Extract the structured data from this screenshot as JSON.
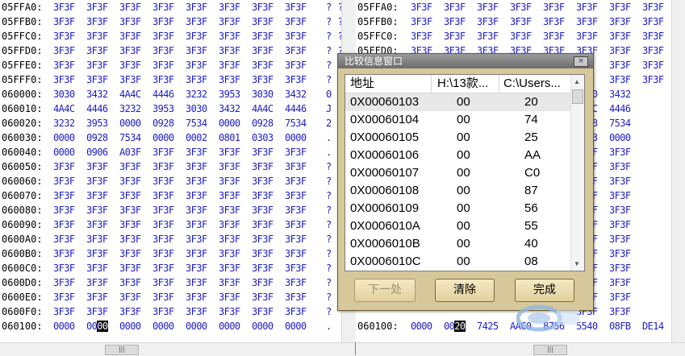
{
  "left_pane": {
    "rows": [
      {
        "addr": "05FFA0:",
        "cells": [
          "3F3F",
          "3F3F",
          "3F3F",
          "3F3F",
          "3F3F",
          "3F3F",
          "3F3F",
          "3F3F"
        ],
        "ascii": "? ?"
      },
      {
        "addr": "05FFB0:",
        "cells": [
          "3F3F",
          "3F3F",
          "3F3F",
          "3F3F",
          "3F3F",
          "3F3F",
          "3F3F",
          "3F3F"
        ],
        "ascii": "? ?"
      },
      {
        "addr": "05FFC0:",
        "cells": [
          "3F3F",
          "3F3F",
          "3F3F",
          "3F3F",
          "3F3F",
          "3F3F",
          "3F3F",
          "3F3F"
        ],
        "ascii": "? ?"
      },
      {
        "addr": "05FFD0:",
        "cells": [
          "3F3F",
          "3F3F",
          "3F3F",
          "3F3F",
          "3F3F",
          "3F3F",
          "3F3F",
          "3F3F"
        ],
        "ascii": "? ?"
      },
      {
        "addr": "05FFE0:",
        "cells": [
          "3F3F",
          "3F3F",
          "3F3F",
          "3F3F",
          "3F3F",
          "3F3F",
          "3F3F",
          "3F3F"
        ],
        "ascii": "?"
      },
      {
        "addr": "05FFF0:",
        "cells": [
          "3F3F",
          "3F3F",
          "3F3F",
          "3F3F",
          "3F3F",
          "3F3F",
          "3F3F",
          "3F3F"
        ],
        "ascii": "?"
      },
      {
        "addr": "060000:",
        "cells": [
          "3030",
          "3432",
          "4A4C",
          "4446",
          "3232",
          "3953",
          "3030",
          "3432"
        ],
        "ascii": "0"
      },
      {
        "addr": "060010:",
        "cells": [
          "4A4C",
          "4446",
          "3232",
          "3953",
          "3030",
          "3432",
          "4A4C",
          "4446"
        ],
        "ascii": "J"
      },
      {
        "addr": "060020:",
        "cells": [
          "3232",
          "3953",
          "0000",
          "0928",
          "7534",
          "0000",
          "0928",
          "7534"
        ],
        "ascii": "2"
      },
      {
        "addr": "060030:",
        "cells": [
          "0000",
          "0928",
          "7534",
          "0000",
          "0002",
          "0801",
          "0303",
          "0000"
        ],
        "ascii": "."
      },
      {
        "addr": "060040:",
        "cells": [
          "0000",
          "0906",
          "A03F",
          "3F3F",
          "3F3F",
          "3F3F",
          "3F3F",
          "3F3F"
        ],
        "ascii": "."
      },
      {
        "addr": "060050:",
        "cells": [
          "3F3F",
          "3F3F",
          "3F3F",
          "3F3F",
          "3F3F",
          "3F3F",
          "3F3F",
          "3F3F"
        ],
        "ascii": "?"
      },
      {
        "addr": "060060:",
        "cells": [
          "3F3F",
          "3F3F",
          "3F3F",
          "3F3F",
          "3F3F",
          "3F3F",
          "3F3F",
          "3F3F"
        ],
        "ascii": "?"
      },
      {
        "addr": "060070:",
        "cells": [
          "3F3F",
          "3F3F",
          "3F3F",
          "3F3F",
          "3F3F",
          "3F3F",
          "3F3F",
          "3F3F"
        ],
        "ascii": "?"
      },
      {
        "addr": "060080:",
        "cells": [
          "3F3F",
          "3F3F",
          "3F3F",
          "3F3F",
          "3F3F",
          "3F3F",
          "3F3F",
          "3F3F"
        ],
        "ascii": "?"
      },
      {
        "addr": "060090:",
        "cells": [
          "3F3F",
          "3F3F",
          "3F3F",
          "3F3F",
          "3F3F",
          "3F3F",
          "3F3F",
          "3F3F"
        ],
        "ascii": "?"
      },
      {
        "addr": "0600A0:",
        "cells": [
          "3F3F",
          "3F3F",
          "3F3F",
          "3F3F",
          "3F3F",
          "3F3F",
          "3F3F",
          "3F3F"
        ],
        "ascii": "?"
      },
      {
        "addr": "0600B0:",
        "cells": [
          "3F3F",
          "3F3F",
          "3F3F",
          "3F3F",
          "3F3F",
          "3F3F",
          "3F3F",
          "3F3F"
        ],
        "ascii": "?"
      },
      {
        "addr": "0600C0:",
        "cells": [
          "3F3F",
          "3F3F",
          "3F3F",
          "3F3F",
          "3F3F",
          "3F3F",
          "3F3F",
          "3F3F"
        ],
        "ascii": "?"
      },
      {
        "addr": "0600D0:",
        "cells": [
          "3F3F",
          "3F3F",
          "3F3F",
          "3F3F",
          "3F3F",
          "3F3F",
          "3F3F",
          "3F3F"
        ],
        "ascii": "?"
      },
      {
        "addr": "0600E0:",
        "cells": [
          "3F3F",
          "3F3F",
          "3F3F",
          "3F3F",
          "3F3F",
          "3F3F",
          "3F3F",
          "3F3F"
        ],
        "ascii": "?"
      },
      {
        "addr": "0600F0:",
        "cells": [
          "3F3F",
          "3F3F",
          "3F3F",
          "3F3F",
          "3F3F",
          "3F3F",
          "3F3F",
          "3F3F"
        ],
        "ascii": "?"
      },
      {
        "addr": "060100:",
        "cells": [
          "0000",
          "00 00",
          "0000",
          "0000",
          "0000",
          "0000",
          "0000",
          "0000"
        ],
        "ascii": ".",
        "highlight": {
          "cell": 1,
          "text": "00"
        }
      }
    ]
  },
  "right_pane": {
    "rows": [
      {
        "addr": "05FFA0:",
        "cells": [
          "3F3F",
          "3F3F",
          "3F3F",
          "3F3F",
          "3F3F",
          "3F3F",
          "3F3F",
          "3F3F"
        ]
      },
      {
        "addr": "05FFB0:",
        "cells": [
          "3F3F",
          "3F3F",
          "3F3F",
          "3F3F",
          "3F3F",
          "3F3F",
          "3F3F",
          "3F3F"
        ]
      },
      {
        "addr": "05FFC0:",
        "cells": [
          "3F3F",
          "3F3F",
          "3F3F",
          "3F3F",
          "3F3F",
          "3F3F",
          "3F3F",
          "3F3F"
        ]
      },
      {
        "addr": "05FFD0:",
        "cells": [
          "3F3F",
          "3F3F",
          "3F3F",
          "3F3F",
          "3F3F",
          "3F3F",
          "3F3F",
          "3F3F"
        ]
      },
      {
        "addr": "",
        "cells": [
          "",
          "",
          "",
          "",
          "",
          "",
          "3F3F",
          "3F3F"
        ]
      },
      {
        "addr": "",
        "cells": [
          "",
          "",
          "",
          "",
          "",
          "",
          "3F3F",
          "3F3F"
        ]
      },
      {
        "addr": "",
        "cells": [
          "",
          "",
          "",
          "",
          "",
          "3030",
          "3432",
          ""
        ]
      },
      {
        "addr": "",
        "cells": [
          "",
          "",
          "",
          "",
          "",
          "4A4C",
          "4446",
          ""
        ]
      },
      {
        "addr": "",
        "cells": [
          "",
          "",
          "",
          "",
          "",
          "0928",
          "7534",
          ""
        ]
      },
      {
        "addr": "",
        "cells": [
          "",
          "",
          "",
          "",
          "",
          "0303",
          "0000",
          ""
        ]
      },
      {
        "addr": "",
        "cells": [
          "",
          "",
          "",
          "",
          "",
          "3F3F",
          "3F3F",
          ""
        ]
      },
      {
        "addr": "",
        "cells": [
          "",
          "",
          "",
          "",
          "",
          "3F3F",
          "3F3F",
          ""
        ]
      },
      {
        "addr": "",
        "cells": [
          "",
          "",
          "",
          "",
          "",
          "3F3F",
          "3F3F",
          ""
        ]
      },
      {
        "addr": "",
        "cells": [
          "",
          "",
          "",
          "",
          "",
          "3F3F",
          "3F3F",
          ""
        ]
      },
      {
        "addr": "",
        "cells": [
          "",
          "",
          "",
          "",
          "",
          "3F3F",
          "3F3F",
          ""
        ]
      },
      {
        "addr": "",
        "cells": [
          "",
          "",
          "",
          "",
          "",
          "3F3F",
          "3F3F",
          ""
        ]
      },
      {
        "addr": "",
        "cells": [
          "",
          "",
          "",
          "",
          "",
          "3F3F",
          "3F3F",
          ""
        ]
      },
      {
        "addr": "",
        "cells": [
          "",
          "",
          "",
          "",
          "",
          "3F3F",
          "3F3F",
          ""
        ]
      },
      {
        "addr": "",
        "cells": [
          "",
          "",
          "",
          "",
          "",
          "3F3F",
          "3F3F",
          ""
        ]
      },
      {
        "addr": "",
        "cells": [
          "",
          "",
          "",
          "",
          "",
          "3F3F",
          "3F3F",
          ""
        ]
      },
      {
        "addr": "",
        "cells": [
          "",
          "",
          "",
          "",
          "",
          "3F3F",
          "3F3F",
          ""
        ]
      },
      {
        "addr": "",
        "cells": [
          "",
          "",
          "",
          "",
          "",
          "3F3F",
          "3F3F",
          ""
        ]
      },
      {
        "addr": "060100:",
        "cells": [
          "0000",
          "00 20",
          "7425",
          "AAC0",
          "8756",
          "5540",
          "08FB",
          "DE14"
        ],
        "highlight": {
          "cell": 1,
          "text": "20"
        }
      }
    ]
  },
  "dialog": {
    "title": "比较信息窗口",
    "close_label": "×",
    "columns": [
      "地址",
      "H:\\13款...",
      "C:\\Users..."
    ],
    "rows": [
      {
        "addr": "0X00060103",
        "left": "00",
        "right": "20"
      },
      {
        "addr": "0X00060104",
        "left": "00",
        "right": "74"
      },
      {
        "addr": "0X00060105",
        "left": "00",
        "right": "25"
      },
      {
        "addr": "0X00060106",
        "left": "00",
        "right": "AA"
      },
      {
        "addr": "0X00060107",
        "left": "00",
        "right": "C0"
      },
      {
        "addr": "0X00060108",
        "left": "00",
        "right": "87"
      },
      {
        "addr": "0X00060109",
        "left": "00",
        "right": "56"
      },
      {
        "addr": "0X0006010A",
        "left": "00",
        "right": "55"
      },
      {
        "addr": "0X0006010B",
        "left": "00",
        "right": "40"
      },
      {
        "addr": "0X0006010C",
        "left": "00",
        "right": "08"
      }
    ],
    "buttons": {
      "next": "下一处",
      "clear": "清除",
      "done": "完成"
    }
  },
  "scrollbar_thumb_label": "|||",
  "colors": {
    "hex_text": "#1d1dc8",
    "dialog_bg": "#d6c89a",
    "title_bar": "#7a7a7a"
  }
}
